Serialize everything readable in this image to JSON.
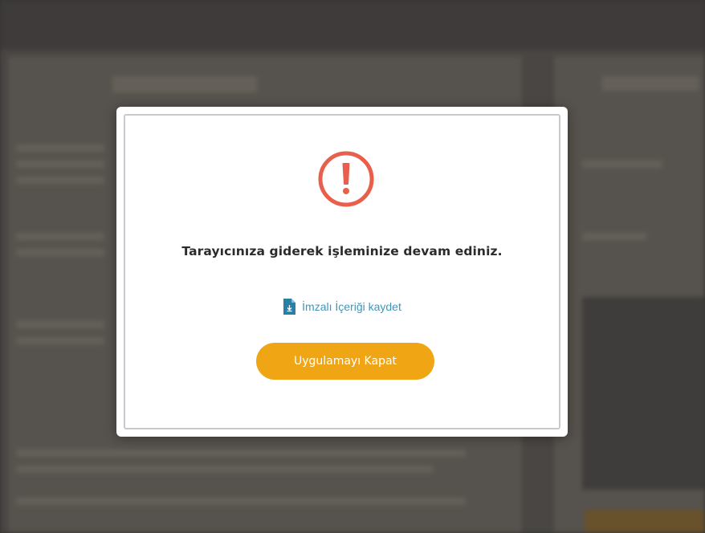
{
  "dialog": {
    "icon": "exclamation-circle-icon",
    "message": "Tarayıcınıza giderek işleminize devam ediniz.",
    "save_link": {
      "icon": "document-download-icon",
      "label": "İmzalı İçeriği kaydet"
    },
    "close_button": "Uygulamayı Kapat"
  },
  "colors": {
    "accent_orange": "#f0a515",
    "alert_red": "#e8604c",
    "link_blue": "#3f97b8"
  }
}
